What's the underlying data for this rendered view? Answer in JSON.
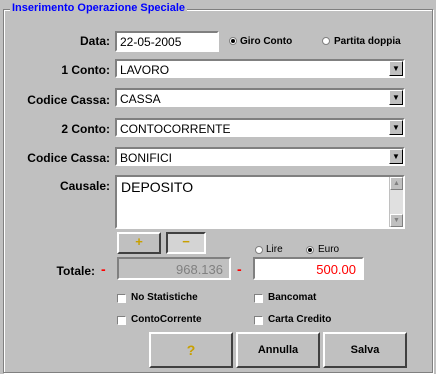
{
  "group": {
    "title": "Inserimento Operazione Speciale"
  },
  "form": {
    "data_label": "Data:",
    "data_value": "22-05-2005",
    "tipo": {
      "option1": "Giro Conto",
      "option2": "Partita doppia",
      "selected": "Giro Conto"
    },
    "conto1_label": "1 Conto:",
    "conto1_value": "LAVORO",
    "cassa1_label": "Codice Cassa:",
    "cassa1_value": "CASSA",
    "conto2_label": "2 Conto:",
    "conto2_value": "CONTOCORRENTE",
    "cassa2_label": "Codice Cassa:",
    "cassa2_value": "BONIFICI",
    "causale_label": "Causale:",
    "causale_value": "DEPOSITO"
  },
  "totale": {
    "plus_label": "+",
    "minus_label": "−",
    "valuta": {
      "option1": "Lire",
      "option2": "Euro",
      "selected": "Euro"
    },
    "label": "Totale:",
    "sign1": "-",
    "lire_value": "968.136",
    "sign2": "-",
    "euro_value": "500.00"
  },
  "checks": {
    "no_statistiche": "No Statistiche",
    "bancomat": "Bancomat",
    "contocorrente": "ContoCorrente",
    "carta_credito": "Carta Credito"
  },
  "buttons": {
    "help_icon": "?",
    "annulla": "Annulla",
    "salva": "Salva"
  },
  "colors": {
    "legend": "#0000ff",
    "accent_red": "#ff0000",
    "plus_icon": "#c8a000"
  }
}
